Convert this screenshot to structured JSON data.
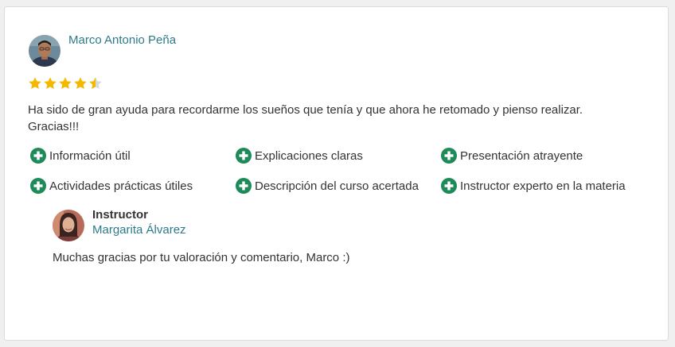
{
  "review": {
    "reviewer_name": "Marco Antonio Peña",
    "rating": 4.5,
    "rating_max": 5,
    "comment": "Ha sido de gran ayuda para recordarme los sueños que tenía y que ahora he retomado y pienso realizar. Gracias!!!",
    "tags": [
      {
        "label": "Información útil",
        "icon": "plus-circle-icon"
      },
      {
        "label": "Explicaciones claras",
        "icon": "plus-circle-icon"
      },
      {
        "label": "Presentación atrayente",
        "icon": "plus-circle-icon"
      },
      {
        "label": "Actividades prácticas útiles",
        "icon": "plus-circle-icon"
      },
      {
        "label": "Descripción del curso acertada",
        "icon": "plus-circle-icon"
      },
      {
        "label": "Instructor experto en la materia",
        "icon": "plus-circle-icon"
      }
    ]
  },
  "reply": {
    "role": "Instructor",
    "name": "Margarita Álvarez",
    "text": "Muchas gracias por tu valoración y comentario, Marco :)"
  },
  "colors": {
    "link": "#2d7a8a",
    "star": "#f5b800",
    "tag_icon": "#1e8a5a",
    "text": "#333333"
  }
}
